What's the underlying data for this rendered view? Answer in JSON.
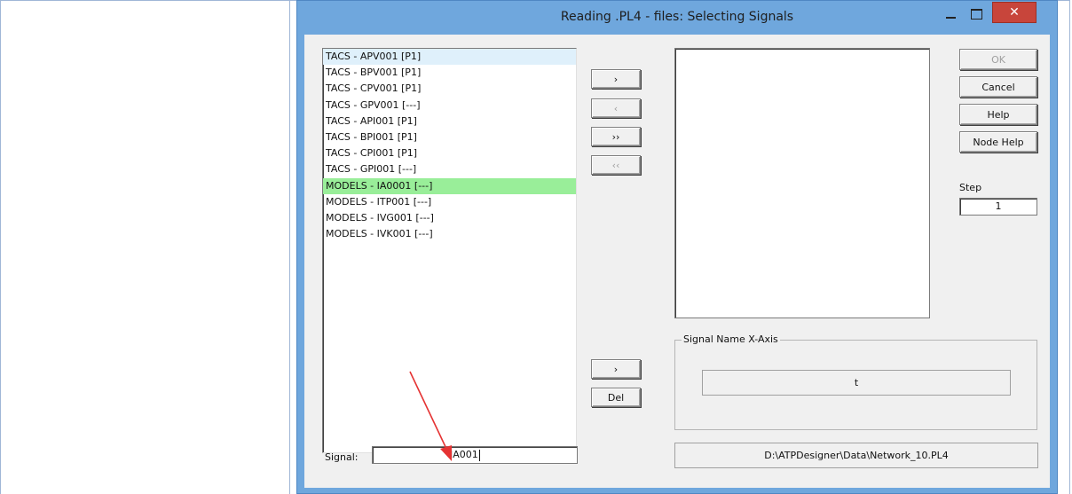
{
  "window": {
    "title": "Reading .PL4 - files: Selecting Signals",
    "close_label": "✕"
  },
  "signals": [
    "TACS - APV001 [P1]",
    "TACS - BPV001 [P1]",
    "TACS - CPV001 [P1]",
    "TACS - GPV001 [---]",
    "TACS - API001 [P1]",
    "TACS - BPI001 [P1]",
    "TACS - CPI001 [P1]",
    "TACS - GPI001 [---]",
    "MODELS - IA0001 [---]",
    "MODELS - ITP001 [---]",
    "MODELS - IVG001 [---]",
    "MODELS - IVK001 [---]"
  ],
  "focused_index": 0,
  "selected_index": 8,
  "buttons": {
    "add": "›",
    "remove": "‹",
    "add_all": "››",
    "remove_all": "‹‹",
    "ok": "OK",
    "cancel": "Cancel",
    "help": "Help",
    "node_help": "Node Help",
    "set_x": "›",
    "del": "Del"
  },
  "step": {
    "label": "Step",
    "value": "1"
  },
  "x_axis": {
    "group_label": "Signal Name X-Axis",
    "value": "t"
  },
  "signal": {
    "label": "Signal:",
    "value": "IA001"
  },
  "file_path": "D:\\ATPDesigner\\Data\\Network_10.PL4",
  "colors": {
    "selected_row": "#99ee99",
    "focused_row": "#dff0fb",
    "title_bar": "#6fa7dd",
    "close_button": "#c8453b",
    "annotation_arrow": "#e53333"
  }
}
